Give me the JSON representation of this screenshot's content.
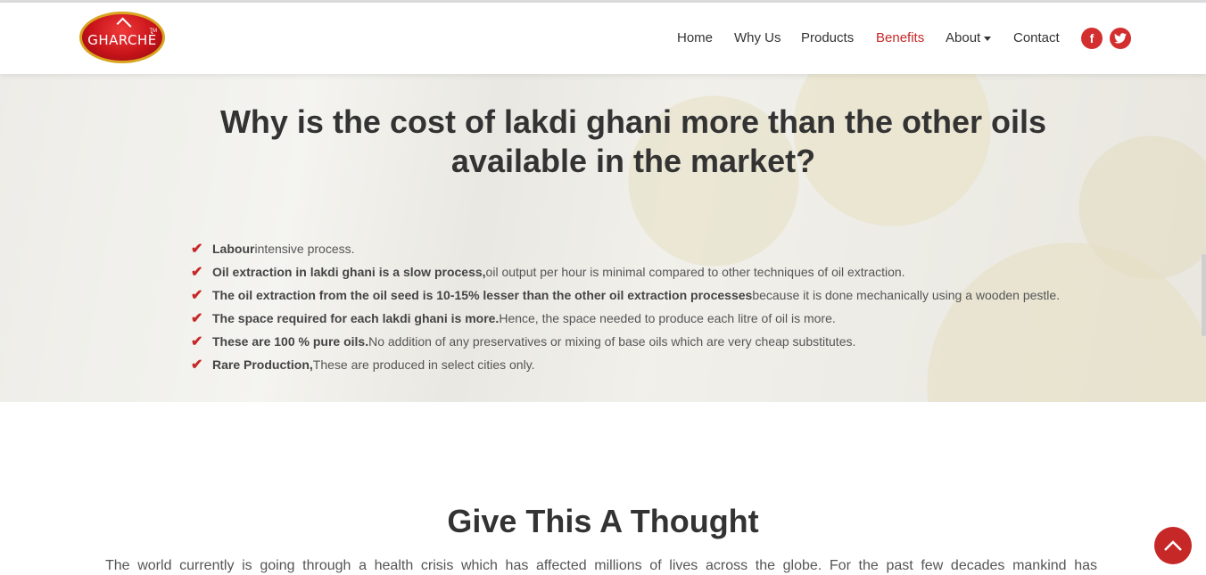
{
  "brand": {
    "logo_text": "GHARCHÈ",
    "tm": "TM"
  },
  "nav": {
    "home": "Home",
    "why_us": "Why Us",
    "products": "Products",
    "benefits": "Benefits",
    "about": "About",
    "contact": "Contact",
    "active": "Benefits"
  },
  "social": {
    "facebook": "f",
    "twitter": "t"
  },
  "hero": {
    "title_line1": "Why is the cost of lakdi ghani more than the other oils",
    "title_line2": "available in the market?",
    "points": [
      {
        "bold": "Labour",
        "text": " intensive process."
      },
      {
        "bold": "Oil extraction in lakdi ghani is a slow process,",
        "text": " oil output per hour is minimal compared to other techniques of oil extraction."
      },
      {
        "bold": "The oil extraction from the oil seed is 10-15% lesser than the other oil extraction processes",
        "text": " because it is done mechanically using a wooden pestle."
      },
      {
        "bold": "The space required for each lakdi ghani is more.",
        "text": " Hence, the space needed to produce each litre of oil is more."
      },
      {
        "bold": "These are 100 % pure oils.",
        "text": "No addition of any preservatives or mixing of base oils which are very cheap substitutes."
      },
      {
        "bold": "Rare Production,",
        "text": " These are produced in select cities only."
      }
    ]
  },
  "thought": {
    "title": "Give This A Thought",
    "para": "The world currently is going through a health crisis which has affected millions of lives across the globe. For the past few decades mankind has"
  },
  "colors": {
    "accent": "#c62828",
    "text": "#333333"
  }
}
